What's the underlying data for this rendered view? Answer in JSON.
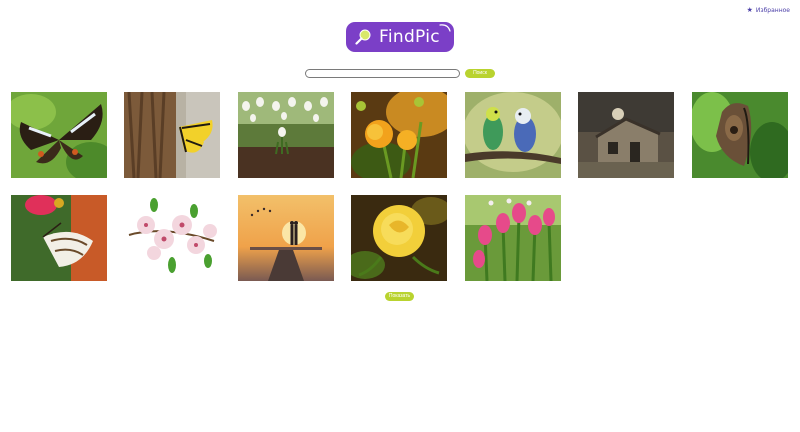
{
  "header": {
    "favorites_label": "Избранное",
    "favorites_icon": "star-icon"
  },
  "logo": {
    "text": "FindPic",
    "icon": "magnifier-icon",
    "bg_color": "#7b3fc7"
  },
  "search": {
    "value": "",
    "placeholder": "",
    "button_label": "Поиск"
  },
  "gallery": {
    "images": [
      {
        "subject": "butterfly"
      },
      {
        "subject": "butterfly on tree bark"
      },
      {
        "subject": "snowdrops"
      },
      {
        "subject": "yellow flowers"
      },
      {
        "subject": "budgerigars"
      },
      {
        "subject": "old house"
      },
      {
        "subject": "butterfly on leaf"
      },
      {
        "subject": "butterfly on flower"
      },
      {
        "subject": "blossom branch"
      },
      {
        "subject": "couple at sunset"
      },
      {
        "subject": "yellow rose"
      },
      {
        "subject": "tulips"
      }
    ]
  },
  "more_button_label": "Показать",
  "colors": {
    "accent_green": "#b9d32f",
    "brand_purple": "#7b3fc7",
    "link_purple": "#4b3fa8"
  }
}
